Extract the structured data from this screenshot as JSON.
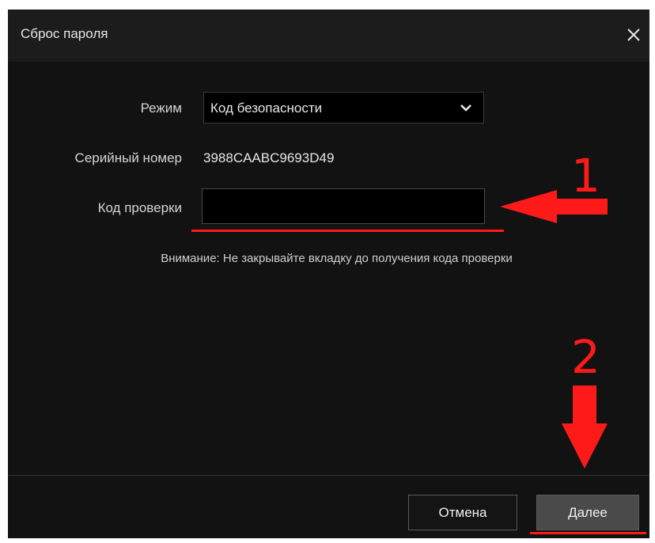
{
  "dialog": {
    "title": "Сброс пароля",
    "close_icon": "close-icon"
  },
  "form": {
    "mode_label": "Режим",
    "mode_value": "Код безопасности",
    "serial_label": "Серийный номер",
    "serial_value": "3988CAABC9693D49",
    "code_label": "Код проверки",
    "code_value": "",
    "notice": "Внимание: Не закрывайте вкладку до получения кода проверки"
  },
  "footer": {
    "cancel_label": "Отмена",
    "next_label": "Далее"
  },
  "annotations": {
    "step1": "1",
    "step2": "2",
    "color": "#ff1a1a"
  }
}
